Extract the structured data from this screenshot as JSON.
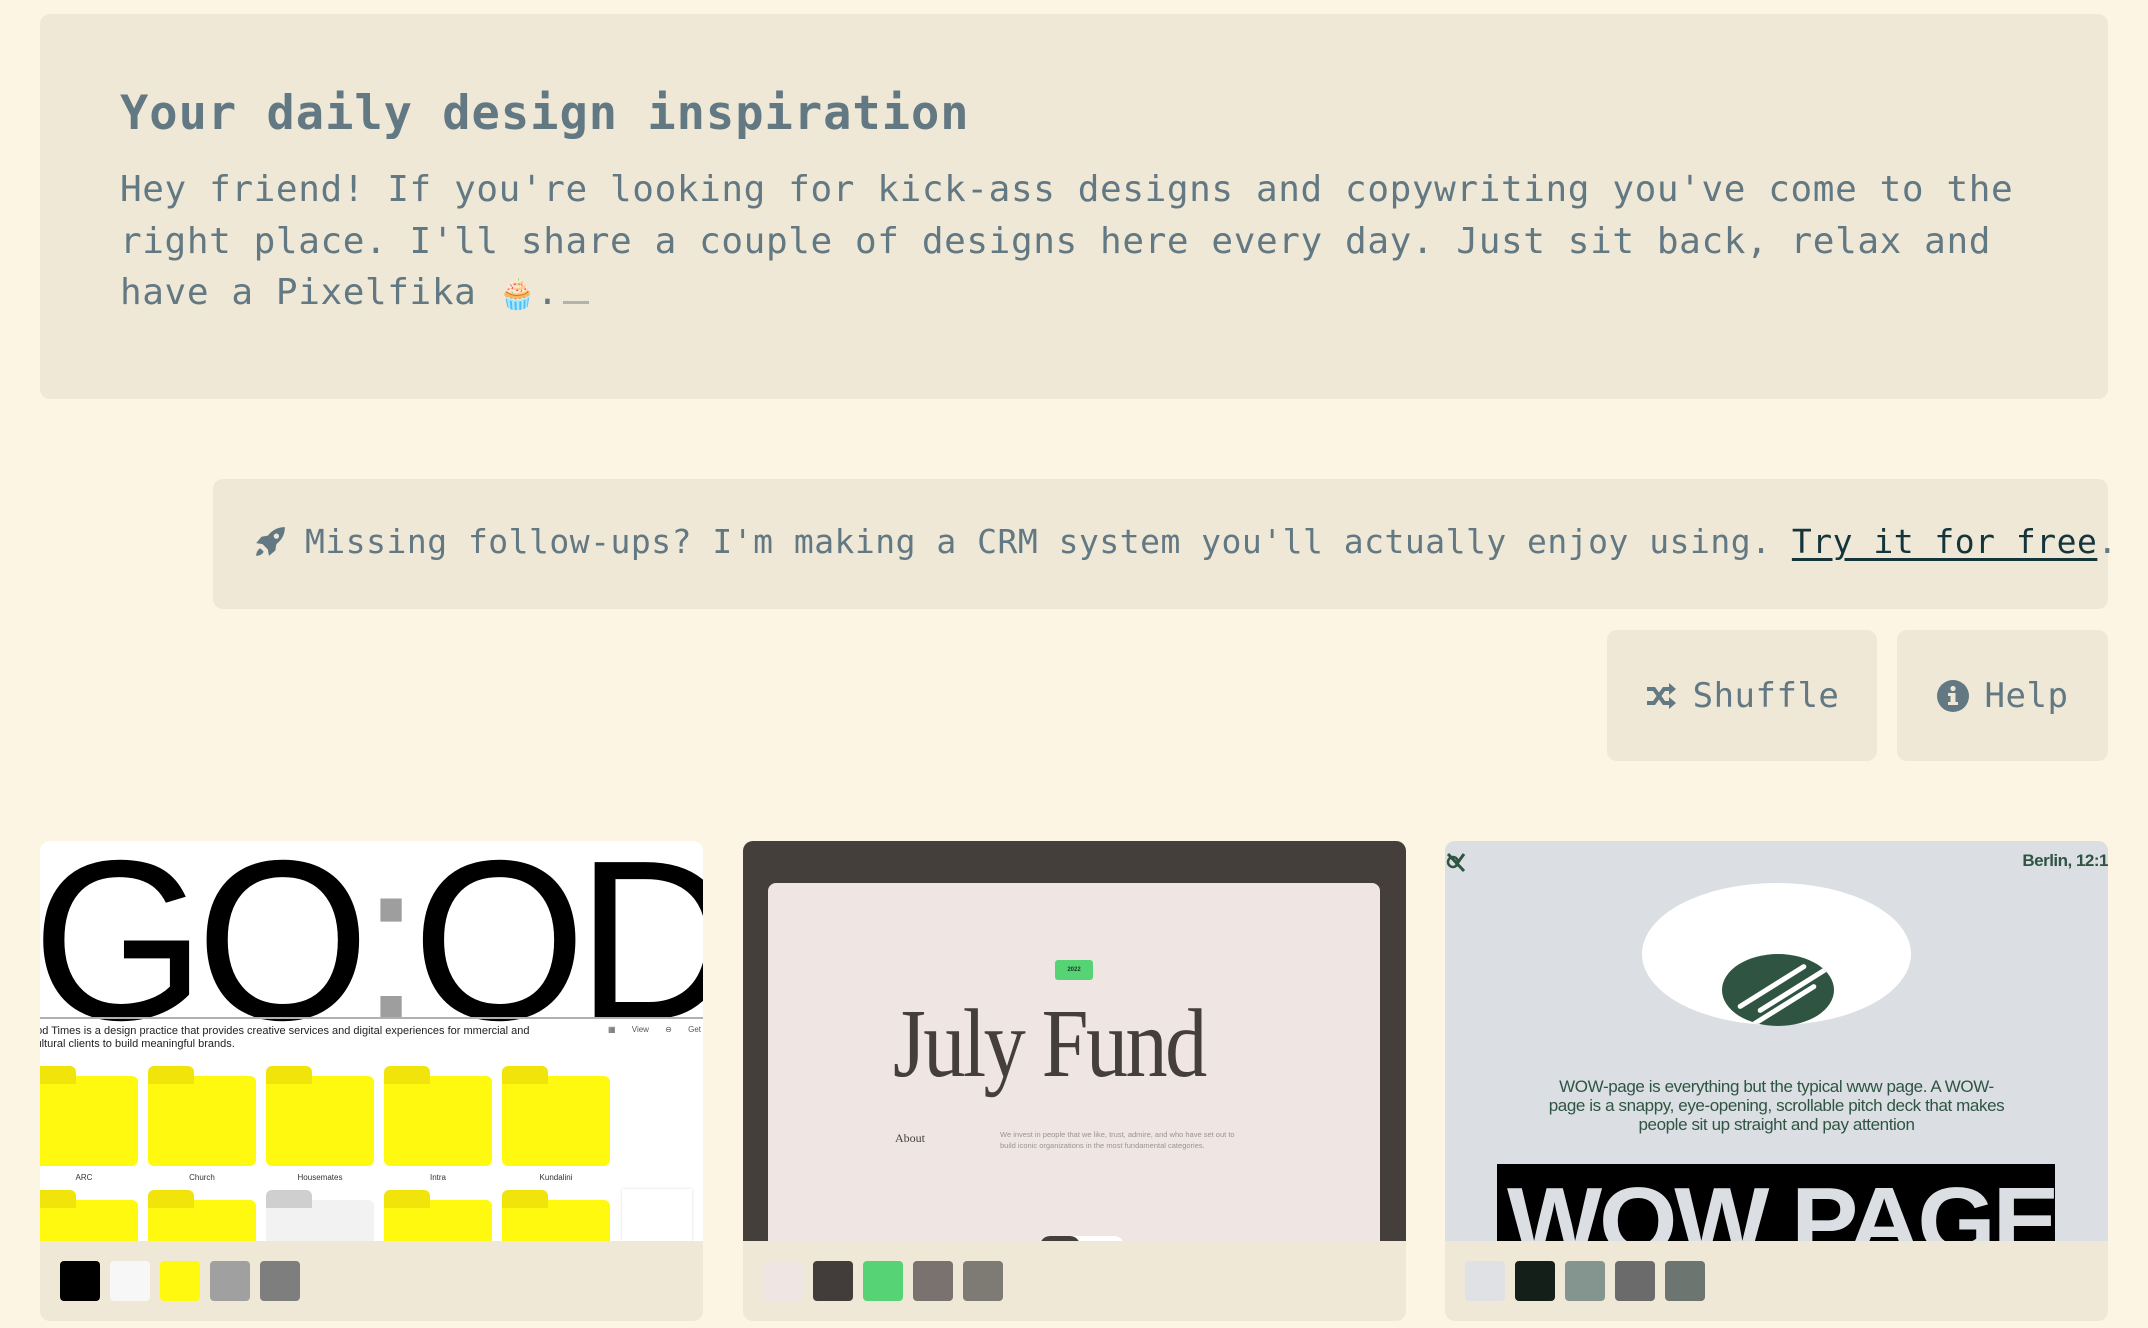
{
  "hero": {
    "title": "Your daily design inspiration",
    "body": "Hey friend! If you're looking for kick-ass designs and copywriting you've come to the right place. I'll share a couple of designs here every day. Just sit back, relax and have a Pixelfika",
    "emoji": "🧁",
    "trailing": "."
  },
  "banner": {
    "icon": "rocket-icon",
    "text": "Missing follow-ups? I'm making a CRM system you'll actually enjoy using.",
    "link_label": "Try it for free",
    "suffix": "."
  },
  "actions": {
    "shuffle": {
      "label": "Shuffle",
      "icon": "shuffle-icon"
    },
    "help": {
      "label": "Help",
      "icon": "info-icon"
    }
  },
  "cards": [
    {
      "name": "Good Times",
      "preview": {
        "wordmark_left": "GO",
        "wordmark_colon": ":",
        "wordmark_right": "OD",
        "description": "ood Times is a design practice that provides creative services and digital experiences for mmercial and cultural clients to build meaningful brands.",
        "meta": "▦ View  ⊖ Get",
        "folders": [
          "ARC",
          "Church",
          "Housemates",
          "Intra",
          "Kundalini"
        ]
      },
      "palette": [
        "#000000",
        "#f7f7f7",
        "#fff90f",
        "#a0a0a0",
        "#7e7e7e"
      ]
    },
    {
      "name": "July Fund",
      "preview": {
        "badge": "2022",
        "title": "July Fund",
        "about_label": "About",
        "about_text": "We invest in people that we like, trust, admire, and who have set out to build iconic organizations in the most fundamental categories."
      },
      "palette": [
        "#efe6e3",
        "#423d3a",
        "#55d375",
        "#7a726e",
        "#7d7b74"
      ]
    },
    {
      "name": "WOW-page",
      "preview": {
        "city": "Berlin, 12:1",
        "blurb": "WOW-page is everything but the typical www page. A WOW-page is a snappy, eye-opening, scrollable pitch deck that makes people sit up straight and pay attention",
        "wordmark": "WOW PAGE"
      },
      "palette": [
        "#dfe1e4",
        "#141f19",
        "#84958f",
        "#6b6b6b",
        "#6d7571"
      ]
    }
  ]
}
